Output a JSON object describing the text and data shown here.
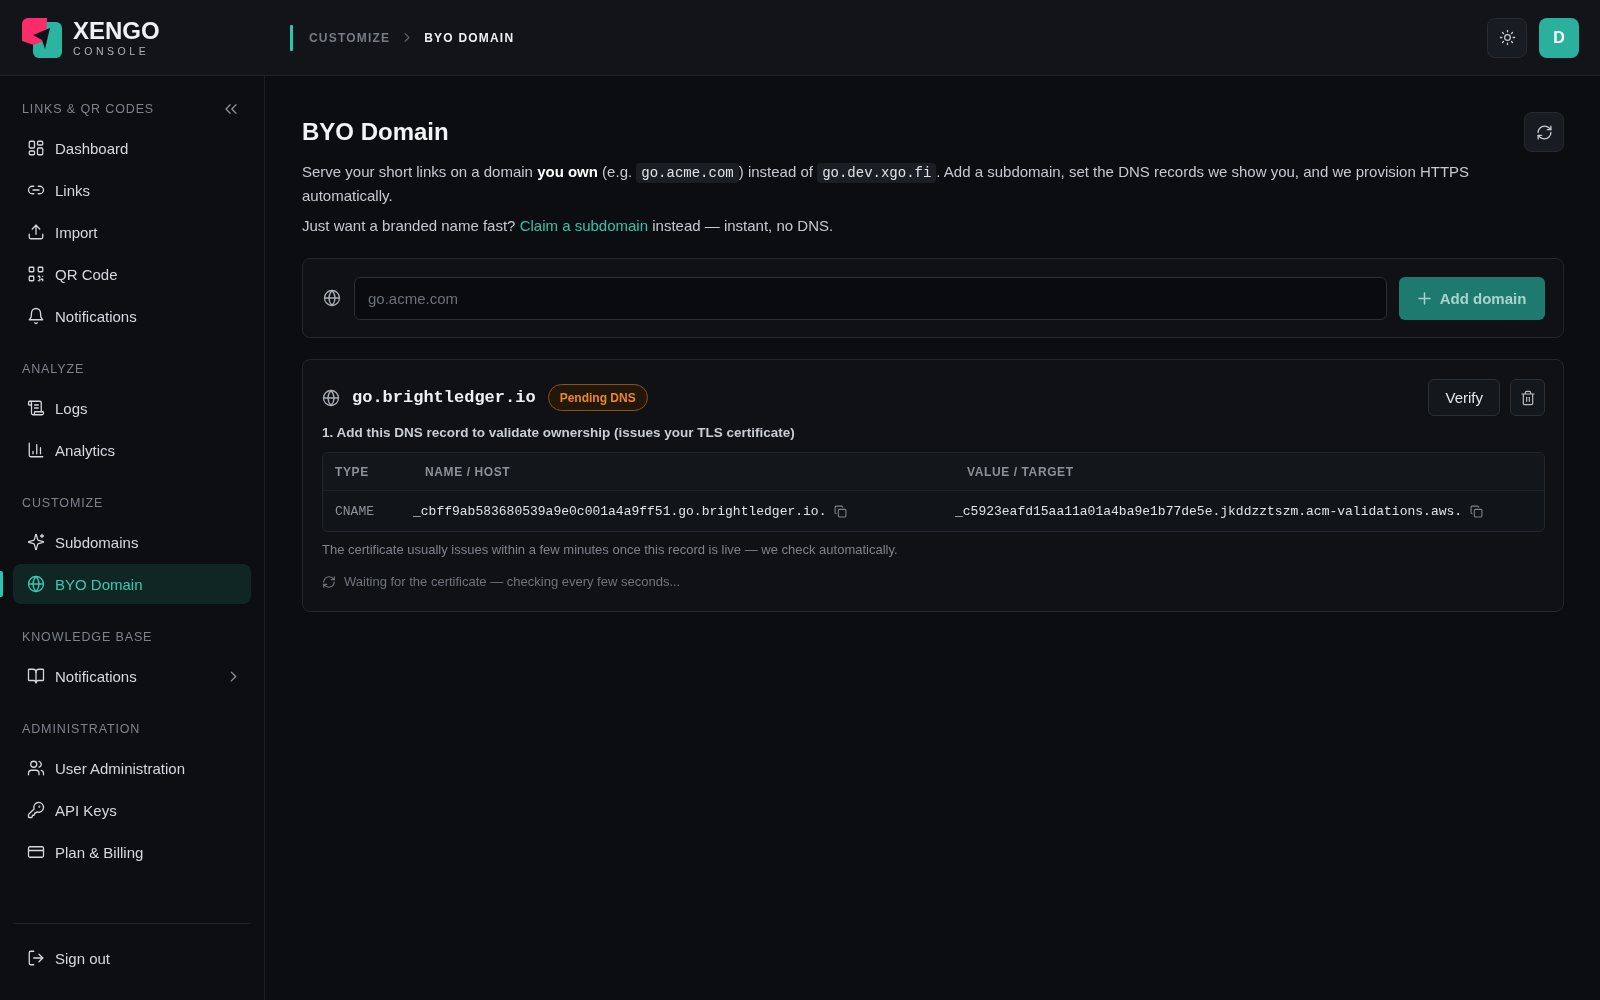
{
  "header": {
    "brand": {
      "name": "XENGO",
      "tagline": "CONSOLE"
    },
    "breadcrumb": [
      {
        "label": "CUSTOMIZE",
        "current": false
      },
      {
        "label": "BYO DOMAIN",
        "current": true
      }
    ],
    "avatar": "D"
  },
  "sidebar": {
    "sections": [
      {
        "title": "LINKS & QR CODES",
        "items": [
          {
            "label": "Dashboard",
            "kind": "dashboard",
            "selected": false,
            "submenu": false
          },
          {
            "label": "Links",
            "kind": "link",
            "selected": false,
            "submenu": false
          },
          {
            "label": "Import",
            "kind": "upload",
            "selected": false,
            "submenu": false
          },
          {
            "label": "QR Code",
            "kind": "qr",
            "selected": false,
            "submenu": false
          },
          {
            "label": "Notifications",
            "kind": "bell",
            "selected": false,
            "submenu": false
          }
        ]
      },
      {
        "title": "ANALYZE",
        "items": [
          {
            "label": "Logs",
            "kind": "logs",
            "selected": false,
            "submenu": false
          },
          {
            "label": "Analytics",
            "kind": "chart",
            "selected": false,
            "submenu": false
          }
        ]
      },
      {
        "title": "CUSTOMIZE",
        "items": [
          {
            "label": "Subdomains",
            "kind": "sparkle",
            "selected": false,
            "submenu": false
          },
          {
            "label": "BYO Domain",
            "kind": "globe",
            "selected": true,
            "submenu": false
          }
        ]
      },
      {
        "title": "KNOWLEDGE BASE",
        "items": [
          {
            "label": "Notifications",
            "kind": "book",
            "selected": false,
            "submenu": true
          }
        ]
      },
      {
        "title": "ADMINISTRATION",
        "items": [
          {
            "label": "User Administration",
            "kind": "users",
            "selected": false,
            "submenu": false
          },
          {
            "label": "API Keys",
            "kind": "key",
            "selected": false,
            "submenu": false
          },
          {
            "label": "Plan & Billing",
            "kind": "card",
            "selected": false,
            "submenu": false
          }
        ]
      }
    ],
    "sign_out": "Sign out"
  },
  "page": {
    "title": "BYO Domain",
    "intro": [
      {
        "kind": "text",
        "text": "Serve your short links on a domain **you own** (e.g. "
      },
      {
        "kind": "code",
        "text": "go.acme.com"
      },
      {
        "kind": "text",
        "text": ") instead of "
      },
      {
        "kind": "code",
        "text": "go.dev.xgo.fi"
      },
      {
        "kind": "text",
        "text": ". Add a subdomain, set the DNS records we show you, and we provision HTTPS automatically."
      }
    ],
    "hint": [
      {
        "kind": "text",
        "text": "Just want a branded name fast? "
      },
      {
        "kind": "link",
        "text": "Claim a subdomain"
      },
      {
        "kind": "text",
        "text": " instead — instant, no DNS."
      }
    ],
    "add_form": {
      "placeholder": "go.acme.com",
      "button": "Add domain",
      "disabled": true
    },
    "domains": [
      {
        "name": "go.brightledger.io",
        "status": {
          "kind": "pending",
          "label": "Pending DNS"
        },
        "verify_button": "Verify",
        "step": "1. Add this DNS record to validate ownership (issues your TLS certificate)",
        "records": {
          "columns": [
            "TYPE",
            "NAME / HOST",
            "VALUE / TARGET"
          ],
          "rows": [
            {
              "type": "CNAME",
              "name": "_cbff9ab583680539a9e0c001a4a9ff51.go.brightledger.io.",
              "value": "_c5923eafd15aa11a01a4ba9e1b77de5e.jkddzztszm.acm-validations.aws."
            }
          ]
        },
        "note": "The certificate usually issues within a few minutes once this record is live — we check automatically.",
        "waiting": "Waiting for the certificate — checking every few seconds..."
      }
    ]
  }
}
